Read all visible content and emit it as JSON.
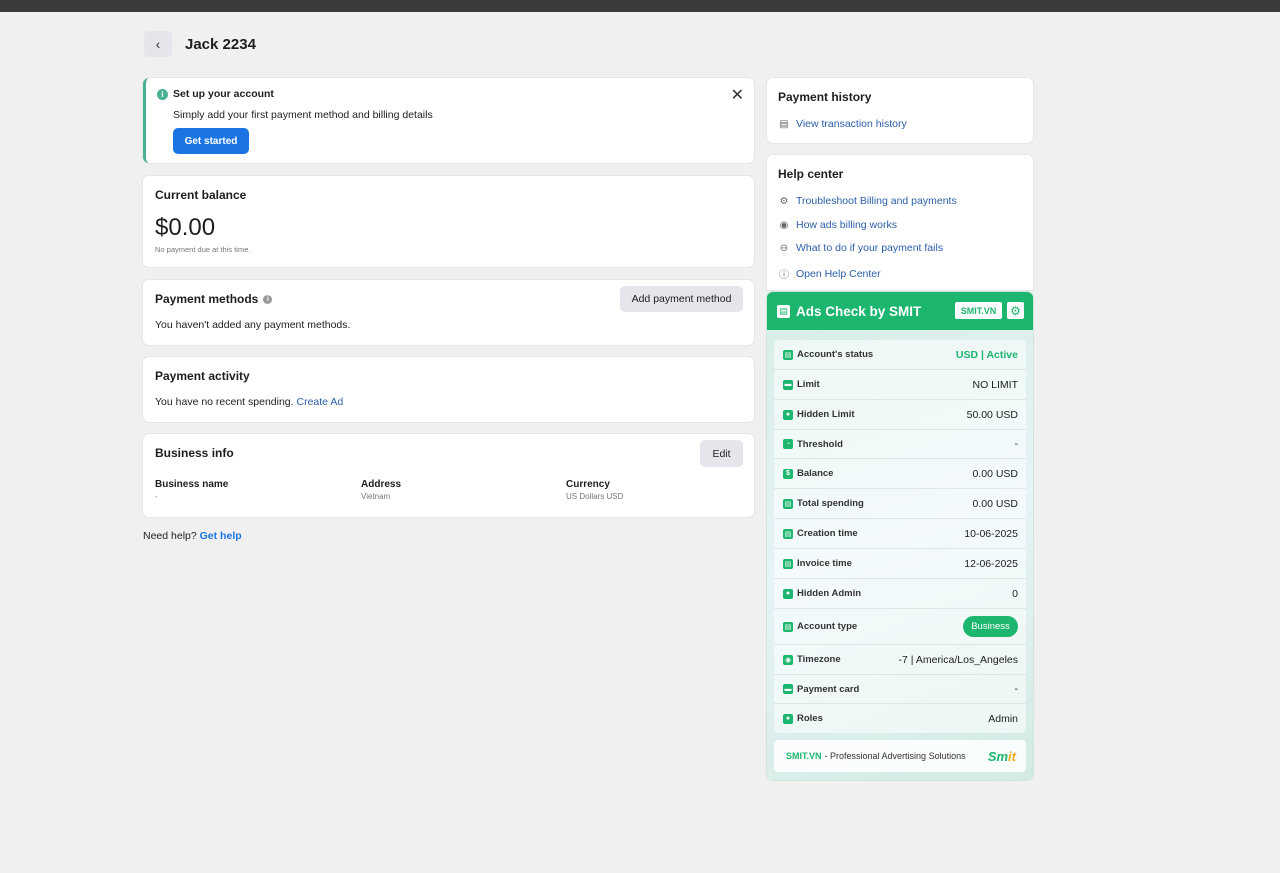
{
  "header": {
    "back_icon": "chevron-left-icon",
    "title": "Jack 2234"
  },
  "setup": {
    "title": "Set up your account",
    "description": "Simply add your first payment method and billing details",
    "button": "Get started",
    "accent": "#4ab195"
  },
  "balance": {
    "title": "Current balance",
    "amount": "$0.00",
    "note": "No payment due at this time."
  },
  "payment_methods": {
    "title": "Payment methods",
    "button": "Add payment method",
    "description": "You haven't added any payment methods."
  },
  "payment_activity": {
    "title": "Payment activity",
    "description": "You have no recent spending.",
    "link": "Create Ad"
  },
  "business_info": {
    "title": "Business info",
    "button": "Edit",
    "columns": [
      {
        "label": "Business name",
        "value": "-"
      },
      {
        "label": "Address",
        "value": "Vietnam"
      },
      {
        "label": "Currency",
        "value": "US Dollars USD"
      }
    ]
  },
  "need_help": {
    "text": "Need help?",
    "link": "Get help"
  },
  "payment_history": {
    "title": "Payment history",
    "link": "View transaction history"
  },
  "help_center": {
    "title": "Help center",
    "links": [
      "Troubleshoot Billing and payments",
      "How ads billing works",
      "What to do if your payment fails",
      "Open Help Center"
    ]
  },
  "smit": {
    "title": "Ads Check by SMIT",
    "badge": "SMIT.VN",
    "brand_color": "#1db66e",
    "rows": [
      {
        "label": "Account's status",
        "value": "USD | Active"
      },
      {
        "label": "Limit",
        "value": "NO LIMIT"
      },
      {
        "label": "Hidden Limit",
        "value": "50.00 USD"
      },
      {
        "label": "Threshold",
        "value": "-"
      },
      {
        "label": "Balance",
        "value": "0.00 USD"
      },
      {
        "label": "Total spending",
        "value": "0.00 USD"
      },
      {
        "label": "Creation time",
        "value": "10-06-2025"
      },
      {
        "label": "Invoice time",
        "value": "12-06-2025"
      },
      {
        "label": "Hidden Admin",
        "value": "0"
      },
      {
        "label": "Account type",
        "value": "Business"
      },
      {
        "label": "Timezone",
        "value": "-7 | America/Los_Angeles"
      },
      {
        "label": "Payment card",
        "value": "-"
      },
      {
        "label": "Roles",
        "value": "Admin"
      }
    ],
    "footer_brand": "SMIT.VN",
    "footer_tagline": "- Professional Advertising Solutions",
    "footer_logo_a": "Sm",
    "footer_logo_b": "it"
  }
}
